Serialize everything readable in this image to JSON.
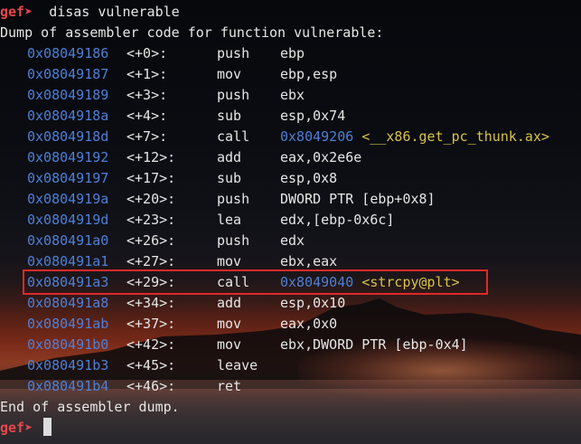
{
  "prompt": {
    "name": "gef",
    "arrow": "➤",
    "command": "disas vulnerable"
  },
  "dump_header": "Dump of assembler code for function vulnerable:",
  "instructions": [
    {
      "addr": "0x08049186",
      "off": "<+0>:",
      "mnemonic": "push",
      "operands": "ebp",
      "target": "",
      "symbol": ""
    },
    {
      "addr": "0x08049187",
      "off": "<+1>:",
      "mnemonic": "mov",
      "operands": "ebp,esp",
      "target": "",
      "symbol": ""
    },
    {
      "addr": "0x08049189",
      "off": "<+3>:",
      "mnemonic": "push",
      "operands": "ebx",
      "target": "",
      "symbol": ""
    },
    {
      "addr": "0x0804918a",
      "off": "<+4>:",
      "mnemonic": "sub",
      "operands": "esp,0x74",
      "target": "",
      "symbol": ""
    },
    {
      "addr": "0x0804918d",
      "off": "<+7>:",
      "mnemonic": "call",
      "operands": "",
      "target": "0x8049206",
      "symbol": "<__x86.get_pc_thunk.ax>"
    },
    {
      "addr": "0x08049192",
      "off": "<+12>:",
      "mnemonic": "add",
      "operands": "eax,0x2e6e",
      "target": "",
      "symbol": ""
    },
    {
      "addr": "0x08049197",
      "off": "<+17>:",
      "mnemonic": "sub",
      "operands": "esp,0x8",
      "target": "",
      "symbol": ""
    },
    {
      "addr": "0x0804919a",
      "off": "<+20>:",
      "mnemonic": "push",
      "operands": "DWORD PTR [ebp+0x8]",
      "target": "",
      "symbol": ""
    },
    {
      "addr": "0x0804919d",
      "off": "<+23>:",
      "mnemonic": "lea",
      "operands": "edx,[ebp-0x6c]",
      "target": "",
      "symbol": ""
    },
    {
      "addr": "0x080491a0",
      "off": "<+26>:",
      "mnemonic": "push",
      "operands": "edx",
      "target": "",
      "symbol": ""
    },
    {
      "addr": "0x080491a1",
      "off": "<+27>:",
      "mnemonic": "mov",
      "operands": "ebx,eax",
      "target": "",
      "symbol": ""
    },
    {
      "addr": "0x080491a3",
      "off": "<+29>:",
      "mnemonic": "call",
      "operands": "",
      "target": "0x8049040",
      "symbol": "<strcpy@plt>"
    },
    {
      "addr": "0x080491a8",
      "off": "<+34>:",
      "mnemonic": "add",
      "operands": "esp,0x10",
      "target": "",
      "symbol": ""
    },
    {
      "addr": "0x080491ab",
      "off": "<+37>:",
      "mnemonic": "mov",
      "operands": "eax,0x0",
      "target": "",
      "symbol": ""
    },
    {
      "addr": "0x080491b0",
      "off": "<+42>:",
      "mnemonic": "mov",
      "operands": "ebx,DWORD PTR [ebp-0x4]",
      "target": "",
      "symbol": ""
    },
    {
      "addr": "0x080491b3",
      "off": "<+45>:",
      "mnemonic": "leave",
      "operands": "",
      "target": "",
      "symbol": ""
    },
    {
      "addr": "0x080491b4",
      "off": "<+46>:",
      "mnemonic": "ret",
      "operands": "",
      "target": "",
      "symbol": ""
    }
  ],
  "dump_footer": "End of assembler dump.",
  "highlighted_instruction_addr": "0x080491a3",
  "colors": {
    "prompt": "#e5484d",
    "address": "#4f7fd6",
    "symbol": "#d9c24a",
    "highlight_box": "#e0292a"
  }
}
